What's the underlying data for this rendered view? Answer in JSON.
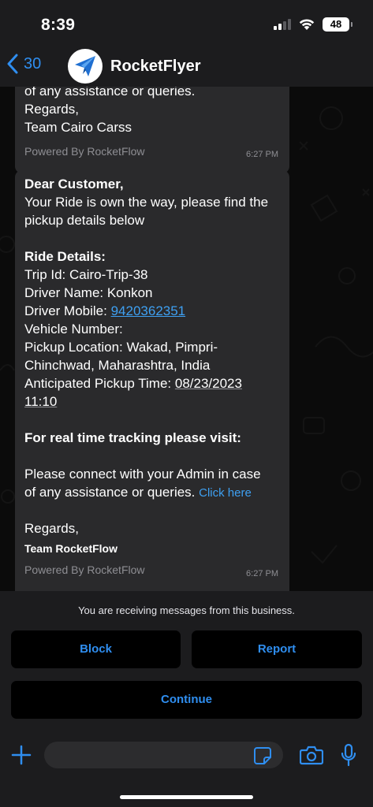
{
  "status": {
    "time": "8:39",
    "battery": "48"
  },
  "header": {
    "back_count": "30",
    "chat_name": "RocketFlyer"
  },
  "messages": [
    {
      "lines": [
        "of any assistance or queries.",
        "Regards,",
        "Team Cairo Carss"
      ],
      "powered_by": "Powered By RocketFlow",
      "time": "6:27 PM"
    },
    {
      "greeting": "Dear Customer,",
      "intro_1": "Your Ride is own the way, please find the",
      "intro_2": "pickup details below",
      "details_title": "Ride Details:",
      "trip_id": "Trip Id: Cairo-Trip-38",
      "driver_name": "Driver Name: Konkon",
      "driver_mobile_label": "Driver Mobile: ",
      "driver_mobile": "9420362351",
      "vehicle_number": "Vehicle Number:",
      "pickup_location_1": "Pickup Location: Wakad, Pimpri-",
      "pickup_location_2": "Chinchwad, Maharashtra, India",
      "pickup_time_label": "Anticipated Pickup Time: ",
      "pickup_date": "08/23/2023",
      "pickup_hour": "11:10",
      "tracking": "For real time tracking please visit:",
      "connect_1": "Please connect with your Admin in case",
      "connect_2": "of any assistance or queries. ",
      "click_here": "Click here",
      "regards": "Regards,",
      "team": "Team RocketFlow",
      "powered_by": "Powered By RocketFlow",
      "time": "6:27 PM"
    }
  ],
  "business_notice": "You are receiving messages from this business.",
  "actions": {
    "block": "Block",
    "report": "Report",
    "continue": "Continue"
  },
  "icons": {
    "back": "chevron-left-icon",
    "plus": "plus-icon",
    "sticker": "sticker-icon",
    "camera": "camera-icon",
    "mic": "microphone-icon"
  },
  "colors": {
    "accent": "#2f8ef0",
    "link": "#3ea0f2",
    "bubble": "#2a2a2c",
    "panel": "#1c1c1e"
  }
}
